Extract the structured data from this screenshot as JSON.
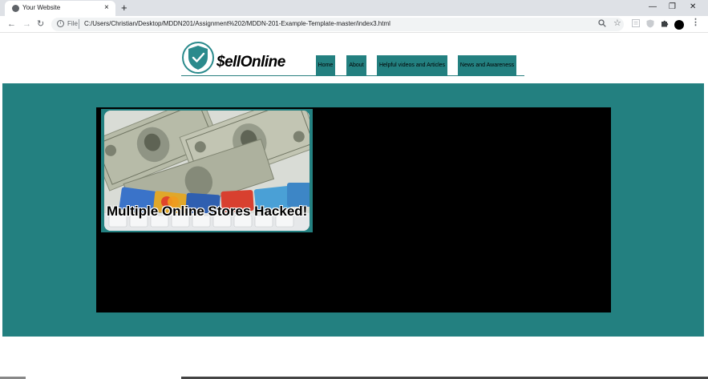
{
  "browser": {
    "tab_title": "Your Website",
    "tab_close": "×",
    "new_tab": "+",
    "window": {
      "minimize": "—",
      "restore": "❐",
      "close": "✕"
    },
    "nav": {
      "back": "←",
      "forward": "→",
      "reload": "↻"
    },
    "address": {
      "scheme_label": "File",
      "url": "C:/Users/Christian/Desktop/MDDN201/Assignment%202/MDDN-201-Example-Template-master/index3.html"
    },
    "toolbar_icons": [
      "zoom-icon",
      "star-icon",
      "reading-list-icon",
      "shield-extension-icon",
      "extensions-puzzle-icon",
      "profile-avatar",
      "menu-kebab-icon"
    ]
  },
  "site": {
    "logo_text": "$ellOnline",
    "nav_items": [
      {
        "label": "Home"
      },
      {
        "label": "About"
      },
      {
        "label": "Helpful videos and Articles"
      },
      {
        "label": "News and Awareness"
      }
    ]
  },
  "content": {
    "card_headline": "Multiple Online Stores Hacked!"
  },
  "colors": {
    "teal": "#238080",
    "panel": "#000000",
    "logo_shield": "#2a8a8c"
  }
}
